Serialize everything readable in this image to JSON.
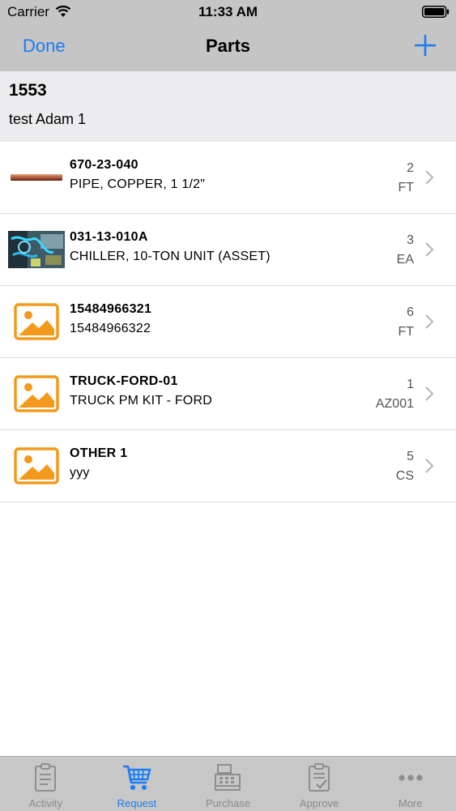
{
  "status_bar": {
    "carrier": "Carrier",
    "time": "11:33 AM"
  },
  "navbar": {
    "done_label": "Done",
    "title": "Parts",
    "add_icon": "plus-icon"
  },
  "work_order": {
    "number": "1553",
    "description": "test Adam 1"
  },
  "parts": [
    {
      "part_number": "670-23-040",
      "description": "PIPE, COPPER, 1 1/2\"",
      "quantity": "2",
      "unit": "FT",
      "image": "copper-pipe-photo"
    },
    {
      "part_number": "031-13-010A",
      "description": "CHILLER, 10-TON UNIT (ASSET)",
      "quantity": "3",
      "unit": "EA",
      "image": "chiller-photo"
    },
    {
      "part_number": "15484966321",
      "description": "15484966322",
      "quantity": "6",
      "unit": "FT",
      "image": "placeholder-image-icon"
    },
    {
      "part_number": "TRUCK-FORD-01",
      "description": "TRUCK PM KIT - FORD",
      "quantity": "1",
      "unit": "AZ001",
      "image": "placeholder-image-icon"
    },
    {
      "part_number": "OTHER 1",
      "description": "yyy",
      "quantity": "5",
      "unit": "CS",
      "image": "placeholder-image-icon"
    }
  ],
  "tabs": [
    {
      "label": "Activity",
      "icon": "clipboard-icon",
      "active": false
    },
    {
      "label": "Request",
      "icon": "cart-icon",
      "active": true
    },
    {
      "label": "Purchase",
      "icon": "register-icon",
      "active": false
    },
    {
      "label": "Approve",
      "icon": "clipboard-check-icon",
      "active": false
    },
    {
      "label": "More",
      "icon": "more-dots-icon",
      "active": false
    }
  ],
  "colors": {
    "accent": "#1a7cf4",
    "placeholder_orange": "#f39a1e",
    "bar_grey": "#c5c5c5"
  }
}
